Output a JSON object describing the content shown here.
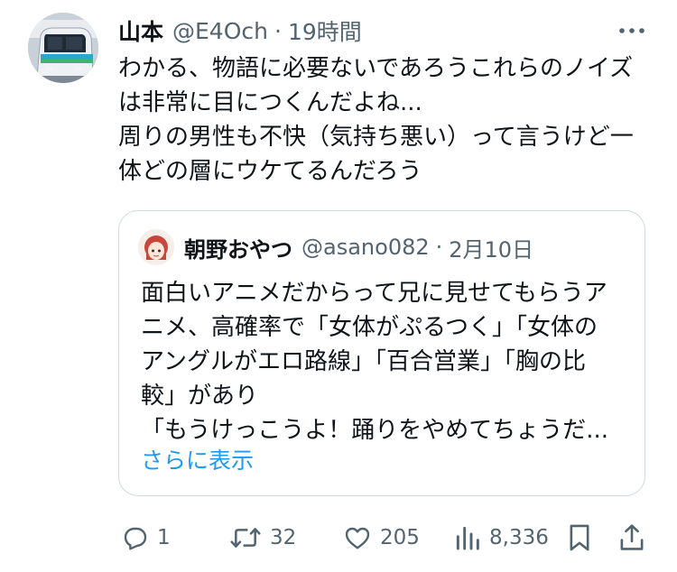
{
  "post": {
    "author_name": "山本",
    "author_handle": "@E4Och",
    "separator": "·",
    "time": "19時間",
    "more_icon": "ellipsis-icon",
    "text_lines": [
      "わかる、物語に必要ないであろうこれらのノイズ",
      "は非常に目につくんだよね...",
      "周りの男性も不快（気持ち悪い）って言うけど一",
      "体どの層にウケてるんだろう"
    ]
  },
  "quote": {
    "author_name": "朝野おやつ",
    "author_handle": "@asano082",
    "separator": "·",
    "time": "2月10日",
    "text_lines": [
      "面白いアニメだからって兄に見せてもらうア",
      "ニメ、高確率で「女体がぷるつく」「女体の",
      "アングルがエロ路線」「百合営業」「胸の比",
      "較」があり",
      "「もうけっこうよ！踊りをやめてちょうだ..."
    ],
    "show_more": "さらに表示"
  },
  "actions": {
    "reply": {
      "icon": "reply-icon",
      "count": "1"
    },
    "repost": {
      "icon": "repost-icon",
      "count": "32"
    },
    "like": {
      "icon": "heart-icon",
      "count": "205"
    },
    "views": {
      "icon": "views-icon",
      "count": "8,336"
    },
    "bookmark": {
      "icon": "bookmark-icon"
    },
    "share": {
      "icon": "share-icon"
    }
  },
  "colors": {
    "text": "#0f1419",
    "secondary": "#536471",
    "link": "#1d9bf0",
    "border": "#cfd9de"
  }
}
